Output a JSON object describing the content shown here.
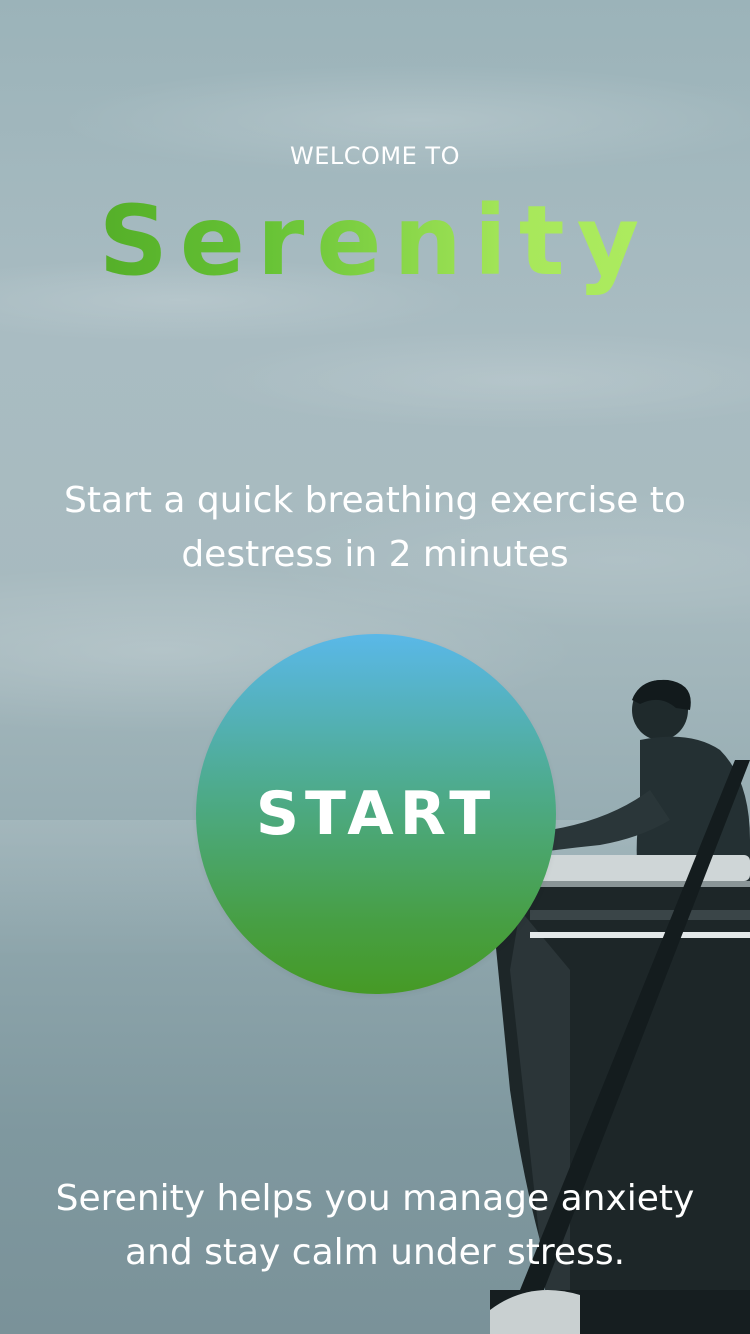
{
  "header": {
    "welcome_text": "WELCOME TO",
    "brand_name": "Serenity"
  },
  "main": {
    "tagline": "Start a quick breathing exercise to destress in 2 minutes",
    "start_label": "START"
  },
  "footer": {
    "text": "Serenity helps you manage anxiety and stay calm under stress."
  },
  "colors": {
    "brand_gradient_start": "#4aa321",
    "brand_gradient_end": "#b0ee62",
    "start_button_top": "#5ab8e8",
    "start_button_bottom": "#469a25",
    "text": "#ffffff"
  },
  "background": {
    "image_subject": "person leaning on railing overlooking misty sea"
  }
}
